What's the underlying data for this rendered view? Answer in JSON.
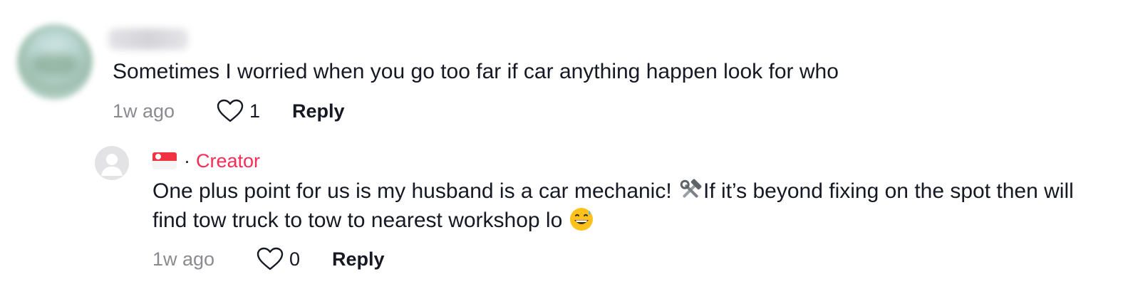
{
  "comment": {
    "text": "Sometimes I worried when you go too far if car anything happen look for who",
    "time": "1w ago",
    "like_count": "1",
    "reply_label": "Reply"
  },
  "reply": {
    "separator": "·",
    "badge": "Creator",
    "text_part1": "One plus point for us is my husband is a car mechanic! ",
    "text_part2": "If it’s beyond fixing on the spot then will find tow truck to tow to nearest workshop lo ",
    "time": "1w ago",
    "like_count": "0",
    "reply_label": "Reply"
  },
  "icons": {
    "flag": "singapore-flag-icon",
    "tools": "hammer-and-wrench-icon",
    "smile": "grinning-face-with-sweat-icon",
    "like": "heart-outline-icon"
  },
  "colors": {
    "creator_accent": "#fe2c55",
    "muted_text": "#8a8b91",
    "primary_text": "#161823"
  }
}
